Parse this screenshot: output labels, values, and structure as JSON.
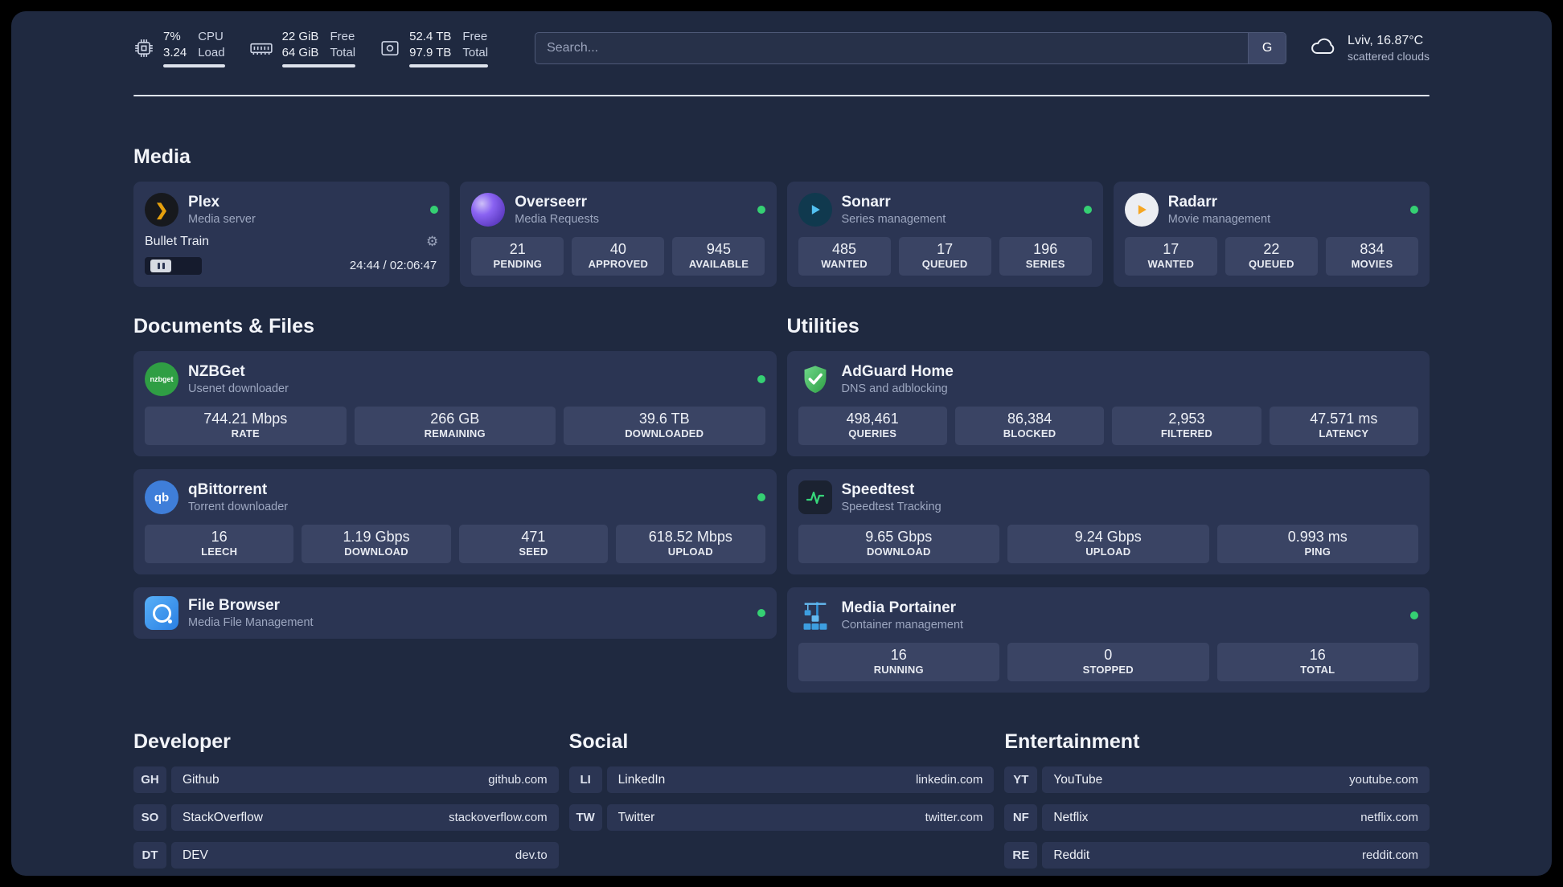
{
  "colors": {
    "status_online": "#35d073",
    "background": "#1f2940",
    "card": "#2b3553"
  },
  "icons": {
    "nzbget_logo_text": "nzbget",
    "qbittorrent_logo_text": "qb"
  },
  "topbar": {
    "cpu": {
      "icon": "cpu-chip-icon",
      "value_top": "7%",
      "label_top": "CPU",
      "value_bottom": "3.24",
      "label_bottom": "Load"
    },
    "memory": {
      "icon": "memory-icon",
      "value_top": "22 GiB",
      "label_top": "Free",
      "value_bottom": "64 GiB",
      "label_bottom": "Total"
    },
    "storage": {
      "icon": "hard-drive-icon",
      "value_top": "52.4 TB",
      "label_top": "Free",
      "value_bottom": "97.9 TB",
      "label_bottom": "Total"
    },
    "search": {
      "placeholder": "Search...",
      "button_label": "G"
    },
    "weather": {
      "icon": "cloud-icon",
      "location_temperature": "Lviv, 16.87°C",
      "condition": "scattered clouds"
    }
  },
  "sections": {
    "media": "Media",
    "documents": "Documents & Files",
    "utilities": "Utilities",
    "developer": "Developer",
    "social": "Social",
    "entertainment": "Entertainment"
  },
  "apps": {
    "plex": {
      "name": "Plex",
      "subtitle": "Media server",
      "status": "online",
      "player": {
        "title": "Bullet Train",
        "time": "24:44 / 02:06:47",
        "progress_percent": 19.5
      }
    },
    "overseerr": {
      "name": "Overseerr",
      "subtitle": "Media Requests",
      "status": "online",
      "stats": [
        {
          "value": "21",
          "label": "PENDING"
        },
        {
          "value": "40",
          "label": "APPROVED"
        },
        {
          "value": "945",
          "label": "AVAILABLE"
        }
      ]
    },
    "sonarr": {
      "name": "Sonarr",
      "subtitle": "Series management",
      "status": "online",
      "stats": [
        {
          "value": "485",
          "label": "WANTED"
        },
        {
          "value": "17",
          "label": "QUEUED"
        },
        {
          "value": "196",
          "label": "SERIES"
        }
      ]
    },
    "radarr": {
      "name": "Radarr",
      "subtitle": "Movie management",
      "status": "online",
      "stats": [
        {
          "value": "17",
          "label": "WANTED"
        },
        {
          "value": "22",
          "label": "QUEUED"
        },
        {
          "value": "834",
          "label": "MOVIES"
        }
      ]
    },
    "nzbget": {
      "name": "NZBGet",
      "subtitle": "Usenet downloader",
      "status": "online",
      "stats": [
        {
          "value": "744.21 Mbps",
          "label": "RATE"
        },
        {
          "value": "266 GB",
          "label": "REMAINING"
        },
        {
          "value": "39.6 TB",
          "label": "DOWNLOADED"
        }
      ]
    },
    "qbittorrent": {
      "name": "qBittorrent",
      "subtitle": "Torrent downloader",
      "status": "online",
      "stats": [
        {
          "value": "16",
          "label": "LEECH"
        },
        {
          "value": "1.19 Gbps",
          "label": "DOWNLOAD"
        },
        {
          "value": "471",
          "label": "SEED"
        },
        {
          "value": "618.52 Mbps",
          "label": "UPLOAD"
        }
      ]
    },
    "filebrowser": {
      "name": "File Browser",
      "subtitle": "Media File Management",
      "status": "online"
    },
    "adguard": {
      "name": "AdGuard Home",
      "subtitle": "DNS and adblocking",
      "stats": [
        {
          "value": "498,461",
          "label": "QUERIES"
        },
        {
          "value": "86,384",
          "label": "BLOCKED"
        },
        {
          "value": "2,953",
          "label": "FILTERED"
        },
        {
          "value": "47.571 ms",
          "label": "LATENCY"
        }
      ]
    },
    "speedtest": {
      "name": "Speedtest",
      "subtitle": "Speedtest Tracking",
      "stats": [
        {
          "value": "9.65 Gbps",
          "label": "DOWNLOAD"
        },
        {
          "value": "9.24 Gbps",
          "label": "UPLOAD"
        },
        {
          "value": "0.993 ms",
          "label": "PING"
        }
      ]
    },
    "portainer": {
      "name": "Media Portainer",
      "subtitle": "Container management",
      "status": "online",
      "stats": [
        {
          "value": "16",
          "label": "RUNNING"
        },
        {
          "value": "0",
          "label": "STOPPED"
        },
        {
          "value": "16",
          "label": "TOTAL"
        }
      ]
    }
  },
  "links": {
    "developer": [
      {
        "abbr": "GH",
        "name": "Github",
        "url": "github.com"
      },
      {
        "abbr": "SO",
        "name": "StackOverflow",
        "url": "stackoverflow.com"
      },
      {
        "abbr": "DT",
        "name": "DEV",
        "url": "dev.to"
      }
    ],
    "social": [
      {
        "abbr": "LI",
        "name": "LinkedIn",
        "url": "linkedin.com"
      },
      {
        "abbr": "TW",
        "name": "Twitter",
        "url": "twitter.com"
      }
    ],
    "entertainment": [
      {
        "abbr": "YT",
        "name": "YouTube",
        "url": "youtube.com"
      },
      {
        "abbr": "NF",
        "name": "Netflix",
        "url": "netflix.com"
      },
      {
        "abbr": "RE",
        "name": "Reddit",
        "url": "reddit.com"
      }
    ]
  }
}
